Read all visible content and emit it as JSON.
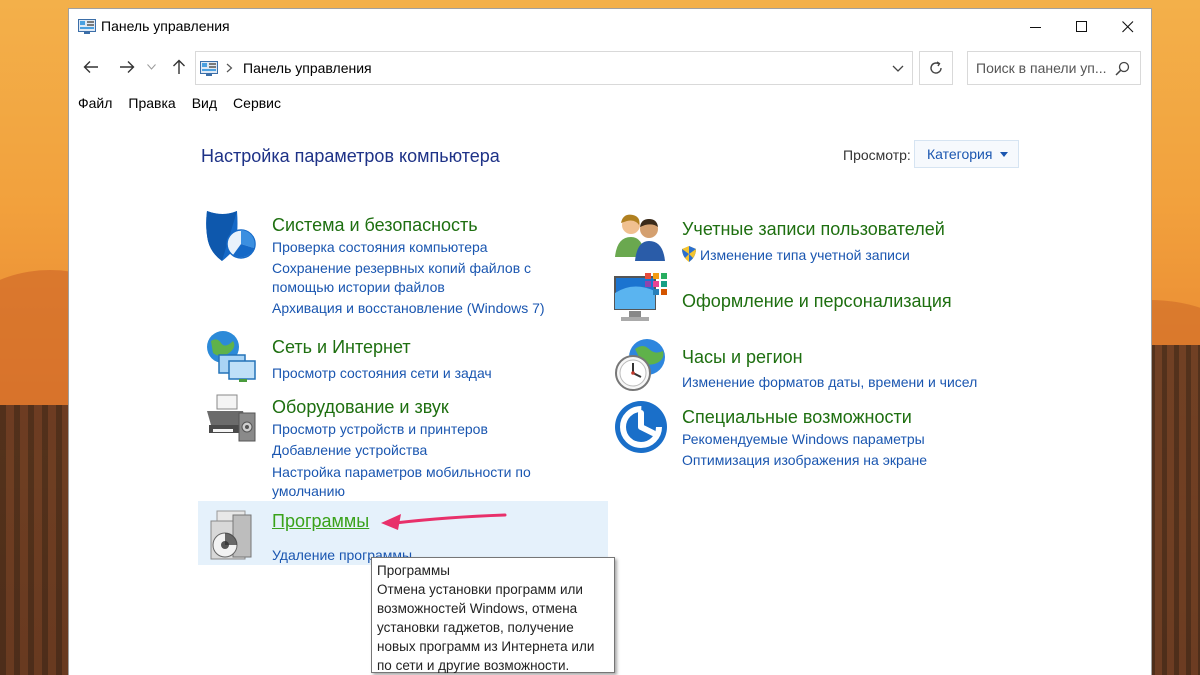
{
  "window": {
    "title": "Панель управления"
  },
  "address": {
    "path": "Панель управления",
    "search_placeholder": "Поиск в панели уп..."
  },
  "menu": {
    "items": [
      "Файл",
      "Правка",
      "Вид",
      "Сервис"
    ]
  },
  "content": {
    "title": "Настройка параметров компьютера",
    "view_label": "Просмотр:",
    "view_value": "Категория"
  },
  "categories": {
    "system": {
      "title": "Система и безопасность",
      "links": [
        "Проверка состояния компьютера",
        "Сохранение резервных копий файлов с",
        "помощью истории файлов",
        "Архивация и восстановление (Windows 7)"
      ]
    },
    "network": {
      "title": "Сеть и Интернет",
      "links": [
        "Просмотр состояния сети и задач"
      ]
    },
    "hardware": {
      "title": "Оборудование и звук",
      "links": [
        "Просмотр устройств и принтеров",
        "Добавление устройства",
        "Настройка параметров мобильности по",
        "умолчанию"
      ]
    },
    "programs": {
      "title": "Программы",
      "links": [
        "Удаление программы"
      ]
    },
    "accounts": {
      "title": "Учетные записи пользователей",
      "links": [
        "Изменение типа учетной записи"
      ]
    },
    "appearance": {
      "title": "Оформление и персонализация",
      "links": []
    },
    "clock": {
      "title": "Часы и регион",
      "links": [
        "Изменение форматов даты, времени и чисел"
      ]
    },
    "access": {
      "title": "Специальные возможности",
      "links": [
        "Рекомендуемые Windows параметры",
        "Оптимизация изображения на экране"
      ]
    }
  },
  "tooltip": {
    "title": "Программы",
    "body": "Отмена установки программ или\nвозможностей Windows, отмена\nустановки гаджетов, получение\nновых программ из Интернета или\nпо сети и другие возможности."
  },
  "colors": {
    "link": "#1a56b0",
    "heading_green": "#1e6f10",
    "title_blue": "#1e3287",
    "highlight": "#e5f1fb",
    "arrow": "#e8306a"
  }
}
